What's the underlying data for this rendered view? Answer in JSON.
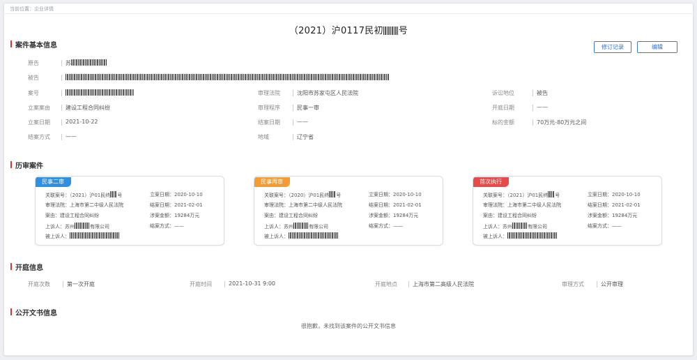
{
  "breadcrumb": "当前位置：企业详情",
  "case_title": "（2021）沪0117民初",
  "case_title_suffix": "号",
  "buttons": {
    "revision": "修订记录",
    "edit": "编辑"
  },
  "sections": {
    "basic": "案件基本信息",
    "history": "历审案件",
    "hearing": "开庭信息",
    "docs": "公开文书信息"
  },
  "basic": {
    "plaintiff_label": "原告",
    "plaintiff_prefix": "苏",
    "defendant_label": "被告",
    "case_no_label": "案号",
    "court_label": "审理法院",
    "court_value": "沈阳市苏家屯区人民法院",
    "status_label": "诉讼地位",
    "status_value": "被告",
    "cause_label": "立案案由",
    "cause_value": "建设工程合同纠纷",
    "procedure_label": "审理程序",
    "procedure_value": "民事一审",
    "hearing_date_label": "开庭日期",
    "hearing_date_value": "——",
    "filing_date_label": "立案日期",
    "filing_date_value": "2021-10-22",
    "close_date_label": "结案日期",
    "close_date_value": "——",
    "amount_label": "标的金额",
    "amount_value": "70万元-80万元之间",
    "close_method_label": "结案方式",
    "close_method_value": "——",
    "region_label": "地域",
    "region_value": "辽宁省"
  },
  "history": [
    {
      "tag": "民事二审",
      "tag_color": "#2f8fe0",
      "l1": "关联案号：（2021）沪01民终",
      "l1s": "号",
      "l2": "审理法院：上海市第二中级人民法院",
      "l3": "案由：建设工程合同纠纷",
      "l4": "上诉人：苏州",
      "l4s": "有限公司",
      "l5": "被上诉人：",
      "r1": "立案日期：2020-10-10",
      "r2": "结案日期：2021-02-01",
      "r3": "涉案金额：19284万元",
      "r4": "结案方式：——"
    },
    {
      "tag": "民事再审",
      "tag_color": "#f39c33",
      "l1": "关联案号：（2020）沪01民终",
      "l1s": "号",
      "l2": "审理法院：上海市第二中级人民法院",
      "l3": "案由：建设工程合同纠纷",
      "l4": "上诉人：苏州",
      "l4s": "有限公司",
      "l5": "被上诉人：",
      "r1": "立案日期：2020-10-10",
      "r2": "结案日期：2021-02-01",
      "r3": "涉案金额：19284万元",
      "r4": "结案方式：——"
    },
    {
      "tag": "首次执行",
      "tag_color": "#e84a4a",
      "l1": "关联案号：（2021）沪01民终",
      "l1s": "号",
      "l2": "审理法院：上海市第二中级人民法院",
      "l3": "案由：建设工程合同纠纷",
      "l4": "上诉人：苏州",
      "l4s": "有限公司",
      "l5": "被上诉人：",
      "r1": "立案日期：2020-10-10",
      "r2": "结案日期：2021-02-01",
      "r3": "涉案金额：19284万元",
      "r4": "结案方式：——"
    }
  ],
  "hearing": {
    "count_label": "开庭次数",
    "count_value": "第一次开庭",
    "time_label": "开庭时间",
    "time_value": "2021-10-31 9:00",
    "place_label": "开庭地点",
    "place_value": "上海市第二高级人民法院",
    "method_label": "审理方式",
    "method_value": "公开审理"
  },
  "docs_empty": "很抱歉，未找到该案件的公开文书信息"
}
